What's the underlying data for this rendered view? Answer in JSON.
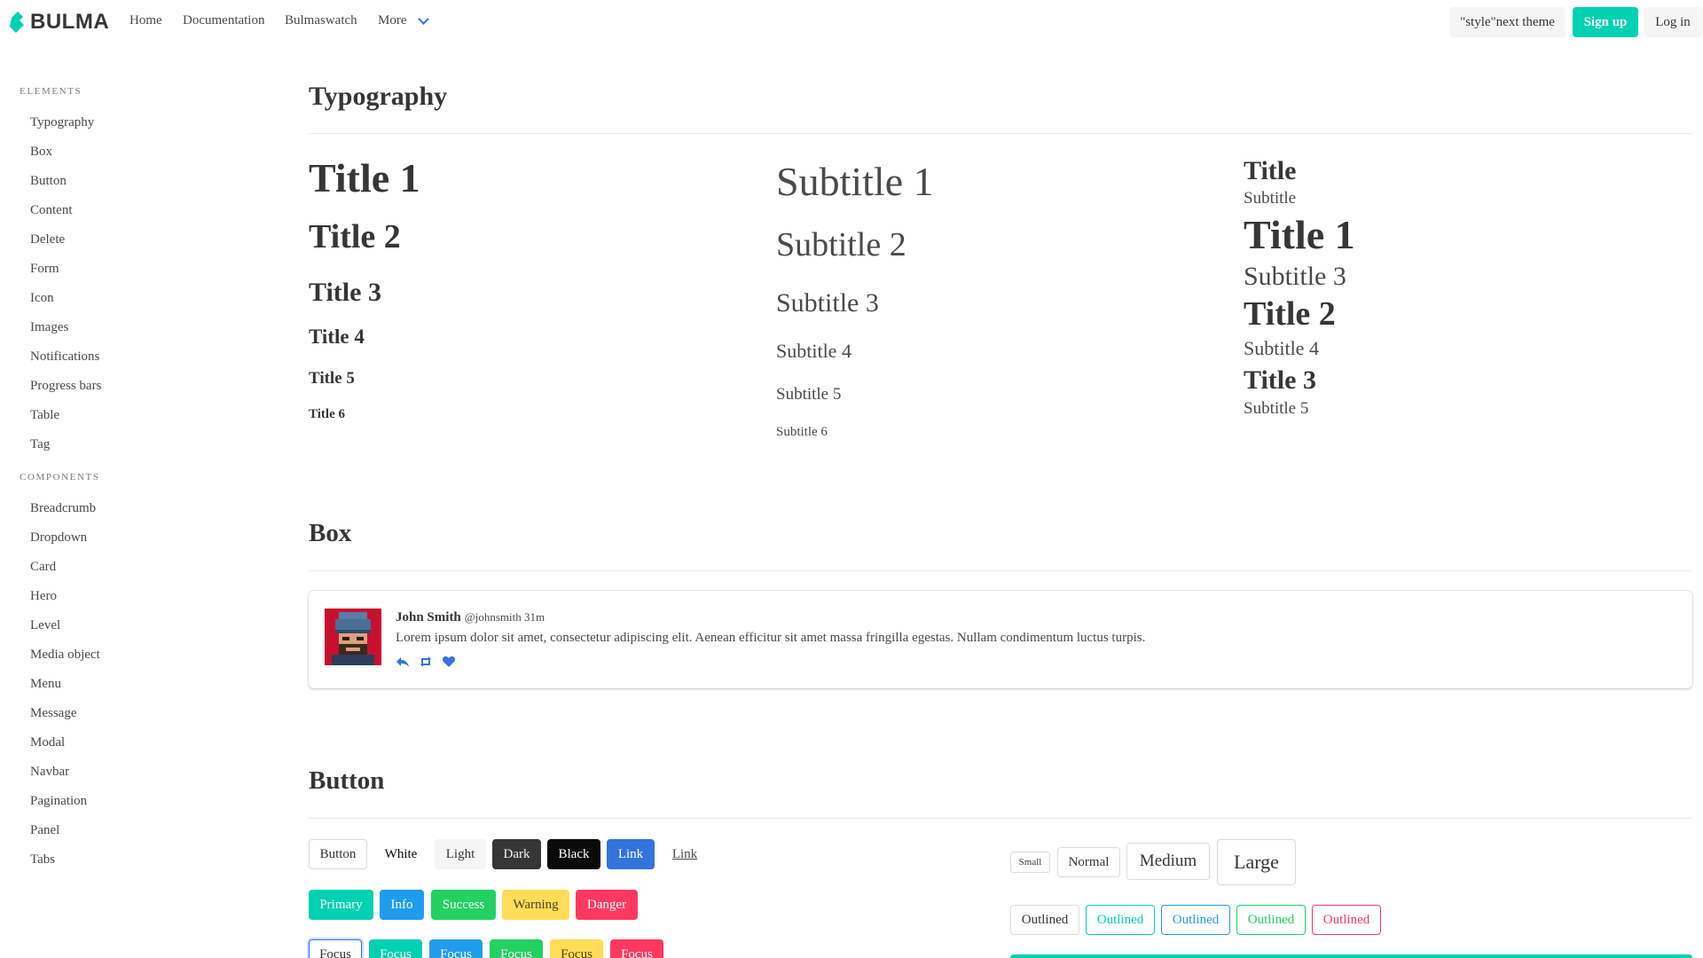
{
  "navbar": {
    "brand": "BULMA",
    "links": [
      "Home",
      "Documentation",
      "Bulmaswatch",
      "More"
    ],
    "theme_button": "\"style\"next theme",
    "signup": "Sign up",
    "login": "Log in"
  },
  "sidebar": {
    "elements_label": "ELEMENTS",
    "elements": [
      "Typography",
      "Box",
      "Button",
      "Content",
      "Delete",
      "Form",
      "Icon",
      "Images",
      "Notifications",
      "Progress bars",
      "Table",
      "Tag"
    ],
    "components_label": "COMPONENTS",
    "components": [
      "Breadcrumb",
      "Dropdown",
      "Card",
      "Hero",
      "Level",
      "Media object",
      "Menu",
      "Message",
      "Modal",
      "Navbar",
      "Pagination",
      "Panel",
      "Tabs"
    ]
  },
  "typography": {
    "heading": "Typography",
    "titles": [
      "Title 1",
      "Title 2",
      "Title 3",
      "Title 4",
      "Title 5",
      "Title 6"
    ],
    "subtitles": [
      "Subtitle 1",
      "Subtitle 2",
      "Subtitle 3",
      "Subtitle 4",
      "Subtitle 5",
      "Subtitle 6"
    ],
    "pairs": [
      "Title",
      "Subtitle",
      "Title 1",
      "Subtitle 3",
      "Title 2",
      "Subtitle 4",
      "Title 3",
      "Subtitle 5"
    ]
  },
  "box": {
    "heading": "Box",
    "name": "John Smith",
    "meta": "@johnsmith 31m",
    "text": "Lorem ipsum dolor sit amet, consectetur adipiscing elit. Aenean efficitur sit amet massa fringilla egestas. Nullam condimentum luctus turpis."
  },
  "button": {
    "heading": "Button",
    "row1": [
      "Button",
      "White",
      "Light",
      "Dark",
      "Black",
      "Link",
      "Link"
    ],
    "row2": [
      "Primary",
      "Info",
      "Success",
      "Warning",
      "Danger"
    ],
    "row3": [
      "Focus",
      "Focus",
      "Focus",
      "Focus",
      "Focus",
      "Focus"
    ],
    "sizes": [
      "Small",
      "Normal",
      "Medium",
      "Large"
    ],
    "outlined": [
      "Outlined",
      "Outlined",
      "Outlined",
      "Outlined",
      "Outlined"
    ]
  },
  "colors": {
    "primary": "#00d1b2",
    "link": "#3273dc",
    "info": "#209cee",
    "success": "#23d160",
    "warning": "#ffdd57",
    "danger": "#ff3860"
  }
}
